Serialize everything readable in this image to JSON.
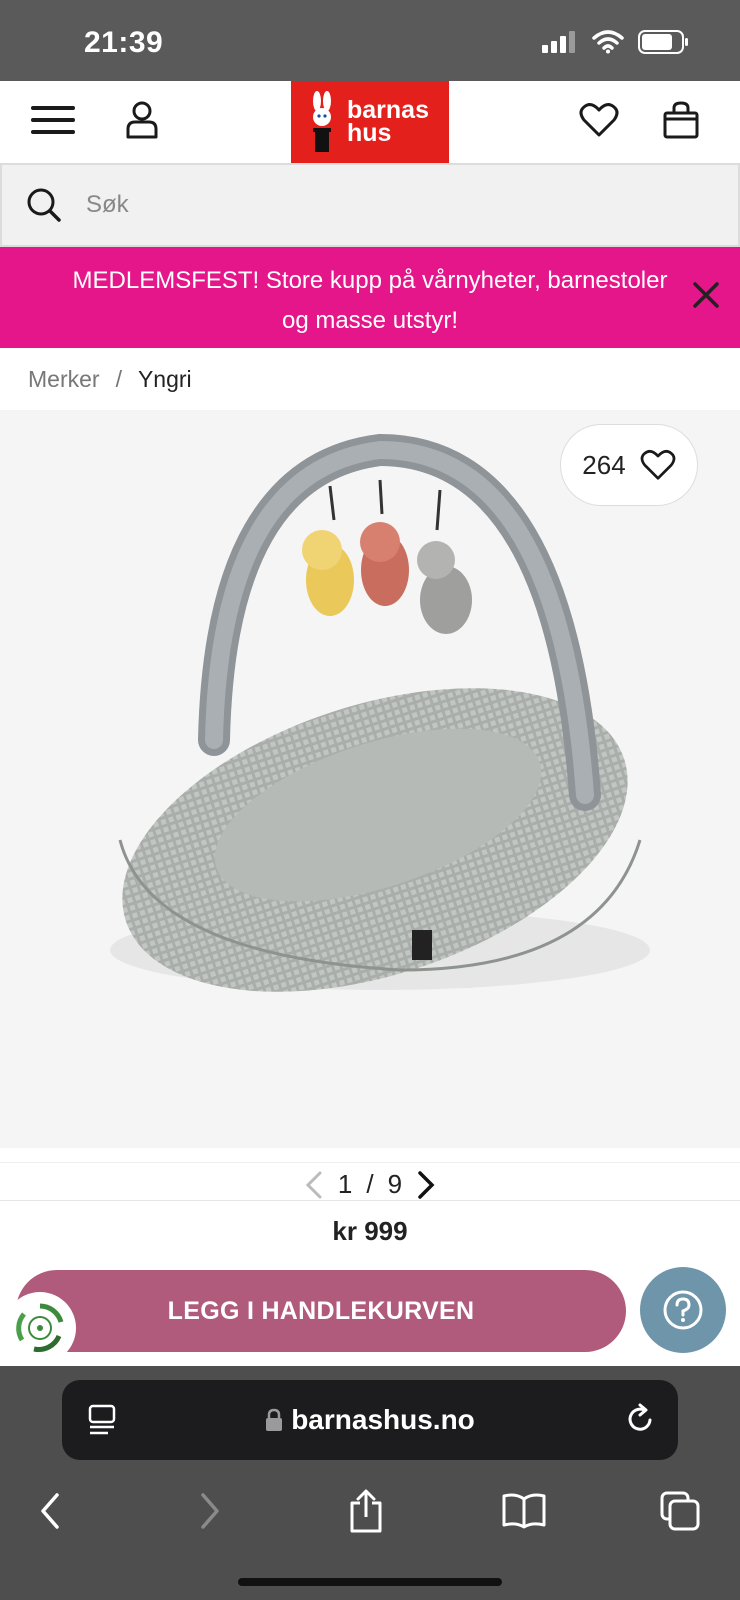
{
  "status_bar": {
    "time": "21:39"
  },
  "header": {
    "logo_text_line1": "barnas",
    "logo_text_line2": "hus"
  },
  "search": {
    "placeholder": "Søk"
  },
  "promo": {
    "text": "MEDLEMSFEST! Store kupp på vårnyheter, barnestoler og masse utstyr!"
  },
  "breadcrumb": {
    "parent": "Merker",
    "separator": "/",
    "current": "Yngri"
  },
  "gallery": {
    "favorite_count": "264",
    "current_index": "1",
    "separator": "/",
    "total": "9"
  },
  "product": {
    "price": "kr 999",
    "add_to_cart_label": "LEGG I HANDLEKURVEN"
  },
  "browser": {
    "url": "barnashus.no"
  },
  "colors": {
    "brand_red": "#e3201b",
    "promo_pink": "#e5168a",
    "cart_button": "#b05a7c",
    "help_button": "#6e95aa"
  },
  "icons": [
    "hamburger-menu-icon",
    "user-icon",
    "heart-icon",
    "shopping-bag-icon",
    "search-icon",
    "close-icon",
    "chevron-left-icon",
    "chevron-right-icon",
    "recycle-badge-icon",
    "help-icon",
    "reader-mode-icon",
    "lock-icon",
    "reload-icon",
    "back-icon",
    "forward-icon",
    "share-icon",
    "bookmarks-icon",
    "tabs-icon"
  ]
}
